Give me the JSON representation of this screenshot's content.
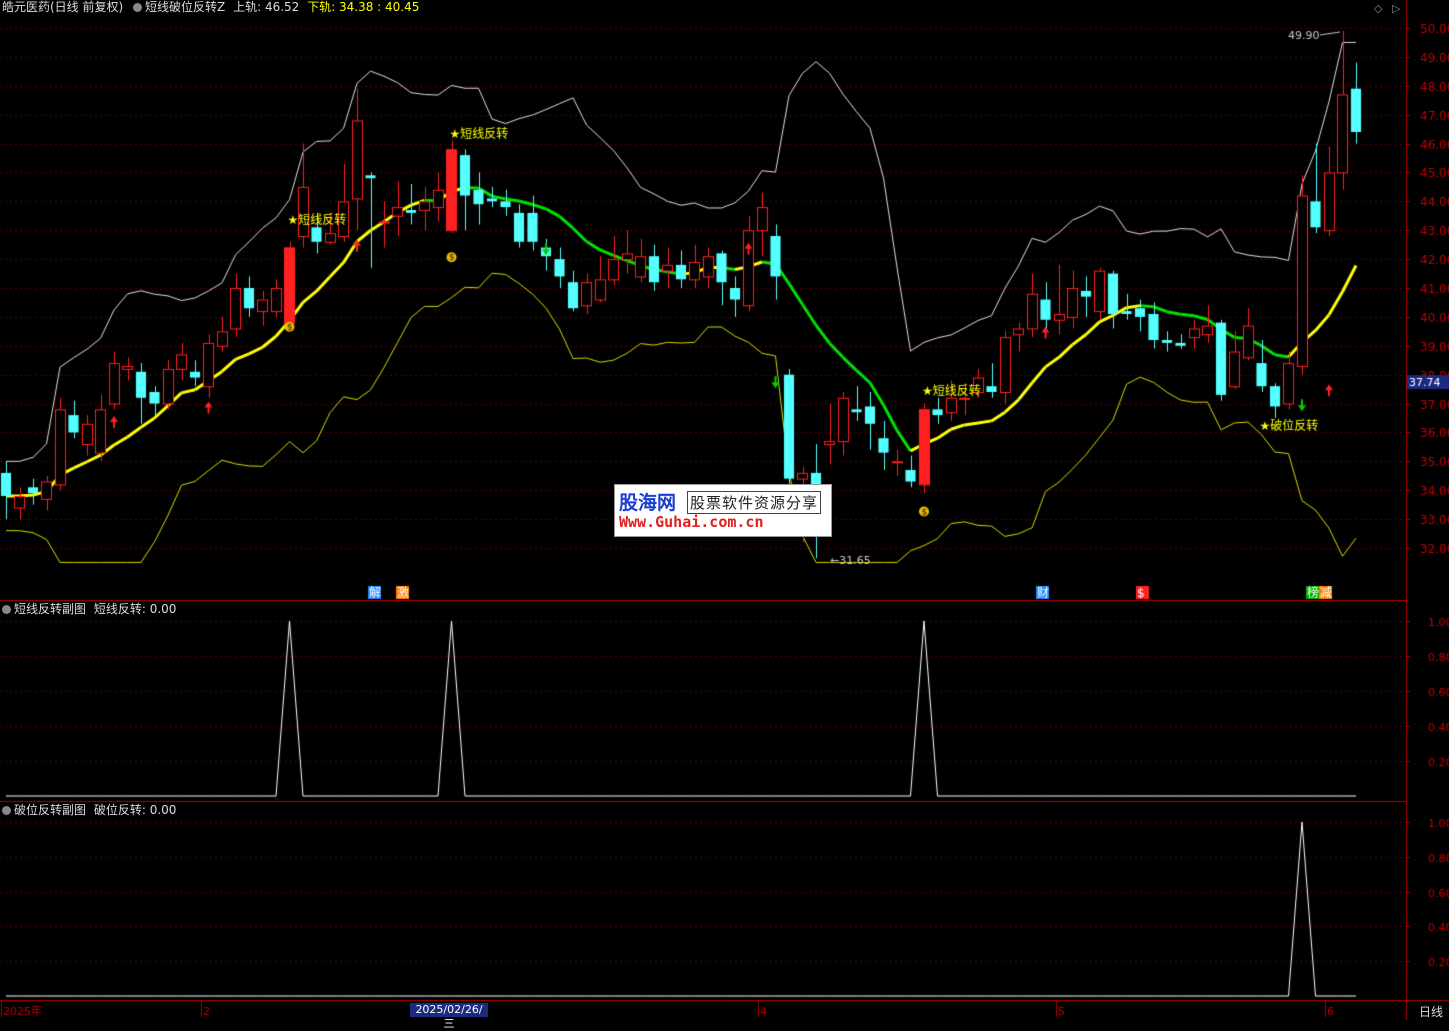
{
  "header": {
    "stock_name": "皓元医药(日线 前复权)",
    "indicator": "短线破位反转Z",
    "upper_label": "上轨:",
    "upper_value": "46.52",
    "lower_label": "下轨:",
    "lower_value": "34.38 : 40.45"
  },
  "sub1": {
    "name": "短线反转副图",
    "series": "短线反转:",
    "value": "0.00"
  },
  "sub2": {
    "name": "破位反转副图",
    "series": "破位反转:",
    "value": "0.00"
  },
  "watermark": {
    "brand": "股海网",
    "slogan": "股票软件资源分享",
    "url": "Www.Guhai.com.cn"
  },
  "footer": {
    "dates": [
      "2025年",
      "2",
      "4",
      "5",
      "6"
    ],
    "cursor_date": "2025/02/26/三",
    "period": "日线"
  },
  "colors": {
    "up": "#ff2020",
    "down": "#54ffff",
    "mid_up": "#ffff00",
    "mid_down": "#00e000",
    "band": "#e0e0e0",
    "lower_band": "#d8d800"
  },
  "chart_data": {
    "type": "candlestick",
    "price_axis": [
      "50.00",
      "49.00",
      "48.00",
      "47.00",
      "46.00",
      "45.00",
      "44.00",
      "43.00",
      "42.00",
      "41.00",
      "40.00",
      "39.00",
      "38.00",
      "37.00",
      "36.00",
      "35.00",
      "34.00",
      "33.00",
      "32.00"
    ],
    "ylim": [
      31.0,
      50.0
    ],
    "current_price": "37.74",
    "high_label": "49.90",
    "low_label": "31.65",
    "signal_labels": [
      "短线反转",
      "短线反转",
      "短线反转",
      "破位反转"
    ],
    "signal_star": "★",
    "event_tags": [
      "解",
      "激",
      "财",
      "$",
      "榜",
      "减"
    ],
    "sub_axis": [
      "1.00",
      "0.80",
      "0.60",
      "0.40",
      "0.20"
    ],
    "candles": [
      [
        34.6,
        33.8,
        35.0,
        33.0
      ],
      [
        33.4,
        33.8,
        34.1,
        33.0
      ],
      [
        34.1,
        33.9,
        34.4,
        33.5
      ],
      [
        33.7,
        34.3,
        34.5,
        33.3
      ],
      [
        34.2,
        36.8,
        37.2,
        34.0
      ],
      [
        36.6,
        36.0,
        37.1,
        35.8
      ],
      [
        35.6,
        36.3,
        36.6,
        35.2
      ],
      [
        35.3,
        36.8,
        37.3,
        35.0
      ],
      [
        37.0,
        38.4,
        38.8,
        36.8
      ],
      [
        38.2,
        38.3,
        38.6,
        37.8
      ],
      [
        38.1,
        37.2,
        38.4,
        36.3
      ],
      [
        37.4,
        37.0,
        37.6,
        36.6
      ],
      [
        37.0,
        38.2,
        38.5,
        36.8
      ],
      [
        38.2,
        38.7,
        39.1,
        37.8
      ],
      [
        38.1,
        37.9,
        38.5,
        37.6
      ],
      [
        37.6,
        39.1,
        39.4,
        37.2
      ],
      [
        39.0,
        39.5,
        40.0,
        38.8
      ],
      [
        39.6,
        41.0,
        41.5,
        39.3
      ],
      [
        41.0,
        40.3,
        41.4,
        40.0
      ],
      [
        40.2,
        40.6,
        40.9,
        39.7
      ],
      [
        40.2,
        41.0,
        41.3,
        40.0
      ],
      [
        39.8,
        42.4,
        42.6,
        39.6
      ],
      [
        42.8,
        44.5,
        46.0,
        42.4
      ],
      [
        43.1,
        42.6,
        43.6,
        42.2
      ],
      [
        42.6,
        42.9,
        43.6,
        42.5
      ],
      [
        42.8,
        44.0,
        45.3,
        42.6
      ],
      [
        44.1,
        46.8,
        47.9,
        43.0
      ],
      [
        44.9,
        44.8,
        45.0,
        41.7
      ],
      [
        43.3,
        43.3,
        44.0,
        42.4
      ],
      [
        43.5,
        43.8,
        44.7,
        42.8
      ],
      [
        43.7,
        43.6,
        44.6,
        43.2
      ],
      [
        43.7,
        44.0,
        44.5,
        43.0
      ],
      [
        43.8,
        44.4,
        45.0,
        43.3
      ],
      [
        43.0,
        45.8,
        46.1,
        42.9
      ],
      [
        45.6,
        44.2,
        45.8,
        43.0
      ],
      [
        44.4,
        43.9,
        45.0,
        43.2
      ],
      [
        44.1,
        44.0,
        44.5,
        43.8
      ],
      [
        44.0,
        43.8,
        44.4,
        43.5
      ],
      [
        43.6,
        42.6,
        43.9,
        42.4
      ],
      [
        43.6,
        42.6,
        44.2,
        42.3
      ],
      [
        42.4,
        42.1,
        42.7,
        41.6
      ],
      [
        42.0,
        41.4,
        42.4,
        41.0
      ],
      [
        41.2,
        40.3,
        41.6,
        40.2
      ],
      [
        40.4,
        41.2,
        41.5,
        40.1
      ],
      [
        40.6,
        41.3,
        42.1,
        40.5
      ],
      [
        41.3,
        42.0,
        42.8,
        41.1
      ],
      [
        42.0,
        42.2,
        43.0,
        41.5
      ],
      [
        41.4,
        42.1,
        42.7,
        41.2
      ],
      [
        42.1,
        41.2,
        42.5,
        40.9
      ],
      [
        41.6,
        41.8,
        42.4,
        41.0
      ],
      [
        41.8,
        41.3,
        42.3,
        41.0
      ],
      [
        41.3,
        41.9,
        42.5,
        41.0
      ],
      [
        41.4,
        42.1,
        42.4,
        41.0
      ],
      [
        42.2,
        41.2,
        42.3,
        40.4
      ],
      [
        41.0,
        40.6,
        41.4,
        40.0
      ],
      [
        40.4,
        43.0,
        43.5,
        40.2
      ],
      [
        43.0,
        43.8,
        44.3,
        42.1
      ],
      [
        42.8,
        41.4,
        43.2,
        40.6
      ],
      [
        38.0,
        34.4,
        38.2,
        34.1
      ],
      [
        34.4,
        34.6,
        34.8,
        32.2
      ],
      [
        34.6,
        34.1,
        35.6,
        31.65
      ],
      [
        35.6,
        35.7,
        37.0,
        34.9
      ],
      [
        35.7,
        37.2,
        37.4,
        35.2
      ],
      [
        36.8,
        36.7,
        37.6,
        36.4
      ],
      [
        36.9,
        36.3,
        37.4,
        35.4
      ],
      [
        35.8,
        35.3,
        36.4,
        34.7
      ],
      [
        35.0,
        35.0,
        35.4,
        34.5
      ],
      [
        34.7,
        34.3,
        35.2,
        34.1
      ],
      [
        34.2,
        36.8,
        37.0,
        33.9
      ],
      [
        36.8,
        36.6,
        37.2,
        36.3
      ],
      [
        36.7,
        37.2,
        37.8,
        36.4
      ],
      [
        37.2,
        37.2,
        37.7,
        36.6
      ],
      [
        37.4,
        37.9,
        38.2,
        37.2
      ],
      [
        37.6,
        37.4,
        38.4,
        37.2
      ],
      [
        37.4,
        39.3,
        39.5,
        37.0
      ],
      [
        39.4,
        39.6,
        39.8,
        38.8
      ],
      [
        39.6,
        40.8,
        41.5,
        39.3
      ],
      [
        40.6,
        39.9,
        41.2,
        39.5
      ],
      [
        39.9,
        40.1,
        41.8,
        39.4
      ],
      [
        40.0,
        41.0,
        41.6,
        39.6
      ],
      [
        40.9,
        40.7,
        41.4,
        40.0
      ],
      [
        40.2,
        41.6,
        41.7,
        39.9
      ],
      [
        41.5,
        40.1,
        41.6,
        39.6
      ],
      [
        40.2,
        40.1,
        40.8,
        39.9
      ],
      [
        40.3,
        40.0,
        40.6,
        39.5
      ],
      [
        40.1,
        39.2,
        40.5,
        38.9
      ],
      [
        39.2,
        39.1,
        39.5,
        38.8
      ],
      [
        39.1,
        39.0,
        39.4,
        38.9
      ],
      [
        39.3,
        39.6,
        39.9,
        38.9
      ],
      [
        39.4,
        39.7,
        40.4,
        39.1
      ],
      [
        39.8,
        37.3,
        39.9,
        37.1
      ],
      [
        37.6,
        38.8,
        39.5,
        37.5
      ],
      [
        38.6,
        39.7,
        40.3,
        38.5
      ],
      [
        38.4,
        37.6,
        39.2,
        37.4
      ],
      [
        37.6,
        36.9,
        37.7,
        36.5
      ],
      [
        37.0,
        38.4,
        38.8,
        36.8
      ],
      [
        38.3,
        44.2,
        44.9,
        38.0
      ],
      [
        44.0,
        43.1,
        46.0,
        42.9
      ],
      [
        43.0,
        45.0,
        45.9,
        42.8
      ],
      [
        45.0,
        47.7,
        49.9,
        44.4
      ],
      [
        47.9,
        46.4,
        48.8,
        46.0
      ]
    ]
  }
}
